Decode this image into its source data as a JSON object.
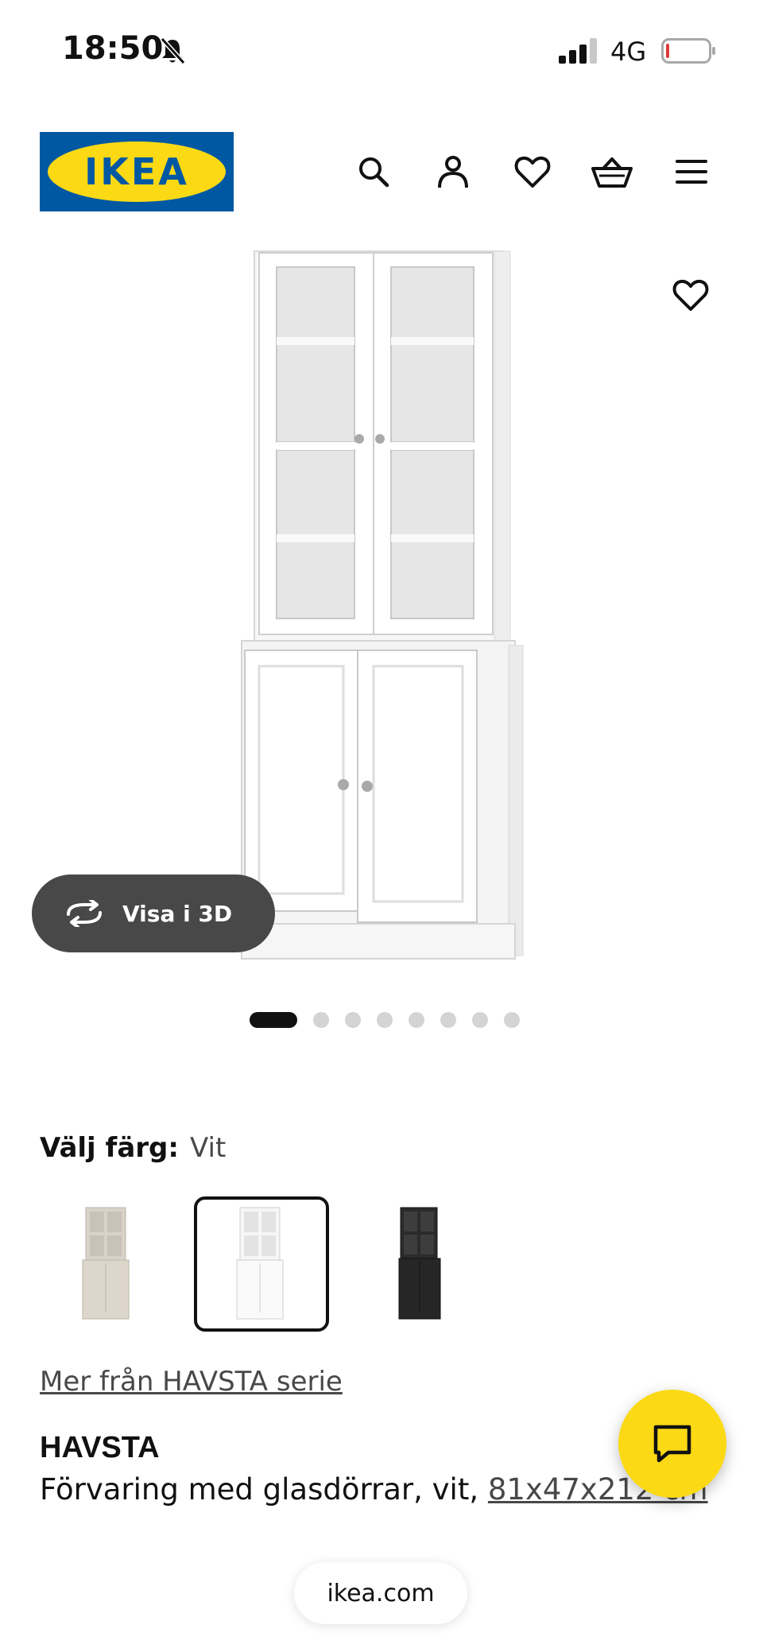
{
  "status_bar": {
    "time": "18:50",
    "network": "4G"
  },
  "header": {
    "logo_text": "IKEA",
    "icons": [
      "search-icon",
      "account-icon",
      "heart-icon",
      "basket-icon",
      "menu-icon"
    ]
  },
  "product_gallery": {
    "view_3d_label": "Visa i 3D",
    "image_count": 8,
    "active_index": 0
  },
  "color_selector": {
    "label": "Välj färg:",
    "selected_value": "Vit",
    "options": [
      "beige",
      "white",
      "black"
    ],
    "selected_index": 1
  },
  "series_link": "Mer från HAVSTA serie",
  "product": {
    "name": "HAVSTA",
    "description": "Förvaring med glasdörrar, vit, ",
    "size": "81x47x212 cm"
  },
  "browser": {
    "url": "ikea.com"
  },
  "colors": {
    "brand_blue": "#0058a3",
    "brand_yellow": "#fbd914",
    "dark": "#111111"
  }
}
